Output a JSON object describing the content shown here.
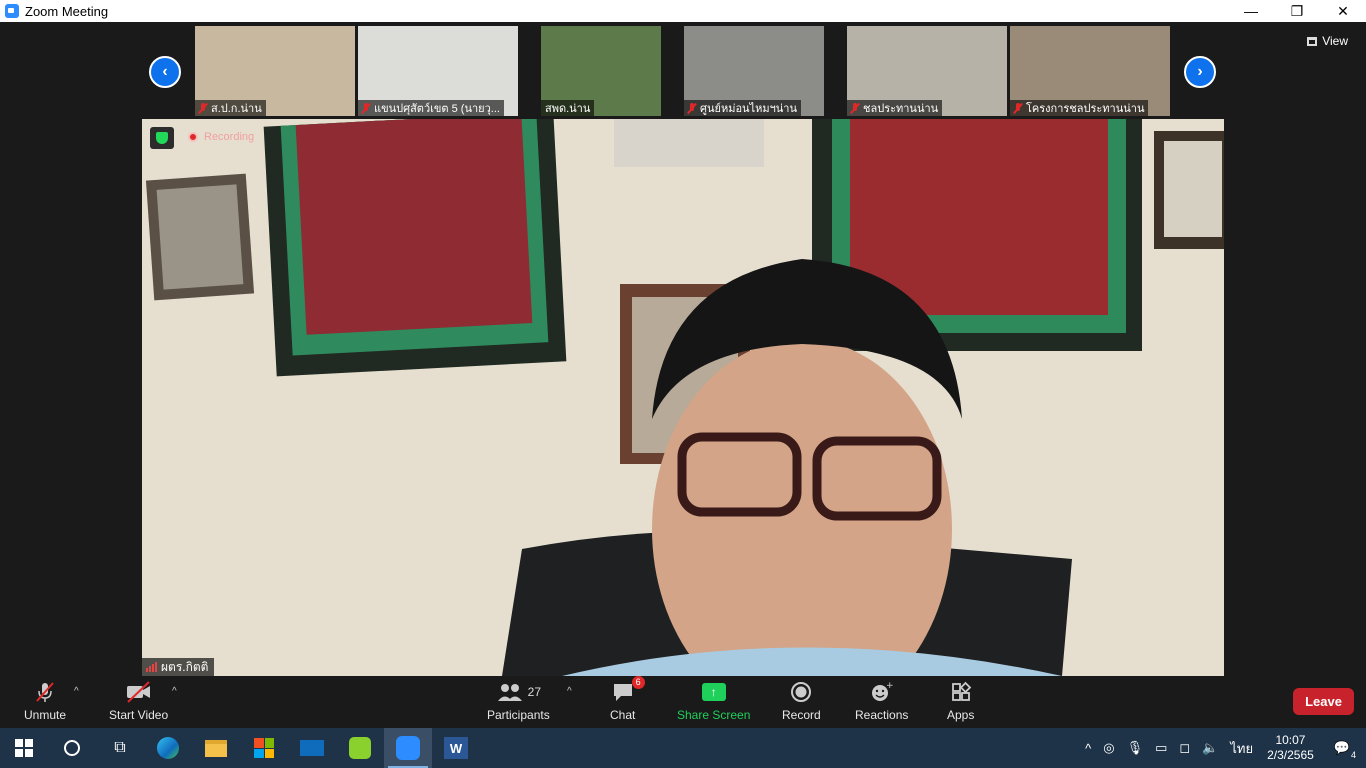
{
  "window": {
    "title": "Zoom Meeting",
    "controls": [
      "—",
      "❐",
      "✕"
    ]
  },
  "gallery": {
    "prev_icon": "chevron-left-icon",
    "next_icon": "chevron-right-icon",
    "view_label": "View",
    "thumbs": [
      {
        "name": "ส.ป.ก.น่าน",
        "muted": true,
        "bg": "#c9b8a0"
      },
      {
        "name": "แขนปศุสัตว์เขต 5 (นายวุ...",
        "muted": true,
        "bg": "#dcdcd8"
      },
      {
        "name": "สพด.น่าน",
        "muted": false,
        "bg": "#5c7a4a"
      },
      {
        "name": "ศูนย์หม่อนไหมฯน่าน",
        "muted": true,
        "bg": "#8c8c88"
      },
      {
        "name": "ชลประทานน่าน",
        "muted": true,
        "bg": "#b7b2a8"
      },
      {
        "name": "โครงการชลประทานน่าน",
        "muted": true,
        "bg": "#9a8a78"
      }
    ]
  },
  "main_video": {
    "recording_label": "Recording",
    "speaker_name": "ผตร.กิตติ"
  },
  "toolbar": {
    "unmute": "Unmute",
    "start_video": "Start Video",
    "participants": "Participants",
    "participants_count": "27",
    "chat": "Chat",
    "chat_badge": "6",
    "share_screen": "Share Screen",
    "record": "Record",
    "reactions": "Reactions",
    "apps": "Apps",
    "leave": "Leave"
  },
  "taskbar": {
    "apps": [
      "windows-start",
      "search",
      "task-view",
      "edge",
      "file-explorer",
      "microsoft-store",
      "mail",
      "line",
      "zoom",
      "word"
    ],
    "language": "ไทย",
    "time": "10:07",
    "date": "2/3/2565",
    "notifications": "4"
  },
  "colors": {
    "accent": "#0e72ed",
    "leave": "#c8232c",
    "share": "#1fd05a",
    "taskbar": "#1e3348"
  }
}
